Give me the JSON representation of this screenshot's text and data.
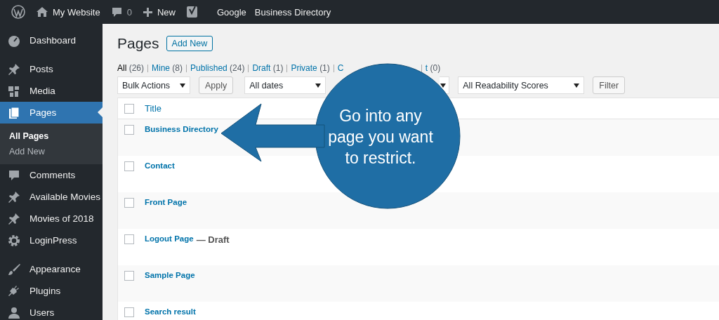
{
  "admin_bar": {
    "site": "My Website",
    "comments": "0",
    "new": "New",
    "links": [
      "Google",
      "Business Directory"
    ]
  },
  "sidebar": {
    "groups": [
      [
        {
          "label": "Dashboard",
          "selected": false
        }
      ],
      [
        {
          "label": "Posts",
          "selected": false
        },
        {
          "label": "Media",
          "selected": false
        },
        {
          "label": "Pages",
          "selected": true,
          "children": [
            {
              "label": "All Pages",
              "selected": true
            },
            {
              "label": "Add New",
              "selected": false
            }
          ]
        },
        {
          "label": "Comments",
          "selected": false
        },
        {
          "label": "Available Movies",
          "selected": false
        },
        {
          "label": "Movies of 2018",
          "selected": false
        },
        {
          "label": "LoginPress",
          "selected": false
        }
      ],
      [
        {
          "label": "Appearance",
          "selected": false
        },
        {
          "label": "Plugins",
          "selected": false
        },
        {
          "label": "Users",
          "selected": false
        }
      ]
    ]
  },
  "page": {
    "title": "Pages",
    "add_new": "Add New",
    "status_links": [
      {
        "label": "All",
        "count": "(26)",
        "selected": true
      },
      {
        "label": "Mine",
        "count": "(8)",
        "selected": false
      },
      {
        "label": "Published",
        "count": "(24)",
        "selected": false
      },
      {
        "label": "Draft",
        "count": "(1)",
        "selected": false
      },
      {
        "label": "Private",
        "count": "(1)",
        "selected": false
      },
      {
        "label": "C",
        "selected": false
      },
      {
        "label": "t",
        "count": "(0)",
        "selected": false
      }
    ],
    "filters": [
      {
        "kind": "select",
        "label": "Bulk Actions"
      },
      {
        "kind": "button",
        "label": "Apply"
      },
      {
        "kind": "select",
        "label": "All dates"
      },
      {
        "kind": "select"
      },
      {
        "kind": "select",
        "label": "All Readability Scores"
      },
      {
        "kind": "button",
        "label": "Filter"
      }
    ],
    "table": {
      "all_checked": false,
      "columns": [
        "Title"
      ],
      "rows": [
        {
          "title": "Business Directory",
          "checked": false
        },
        {
          "title": "Contact",
          "checked": false
        },
        {
          "title": "Front Page",
          "checked": false
        },
        {
          "title": "Logout Page",
          "state": "— Draft",
          "checked": false
        },
        {
          "title": "Sample Page",
          "checked": false
        },
        {
          "title": "Search result",
          "checked": false
        }
      ]
    }
  },
  "callout": {
    "text": "Go into any page you want to restrict."
  }
}
